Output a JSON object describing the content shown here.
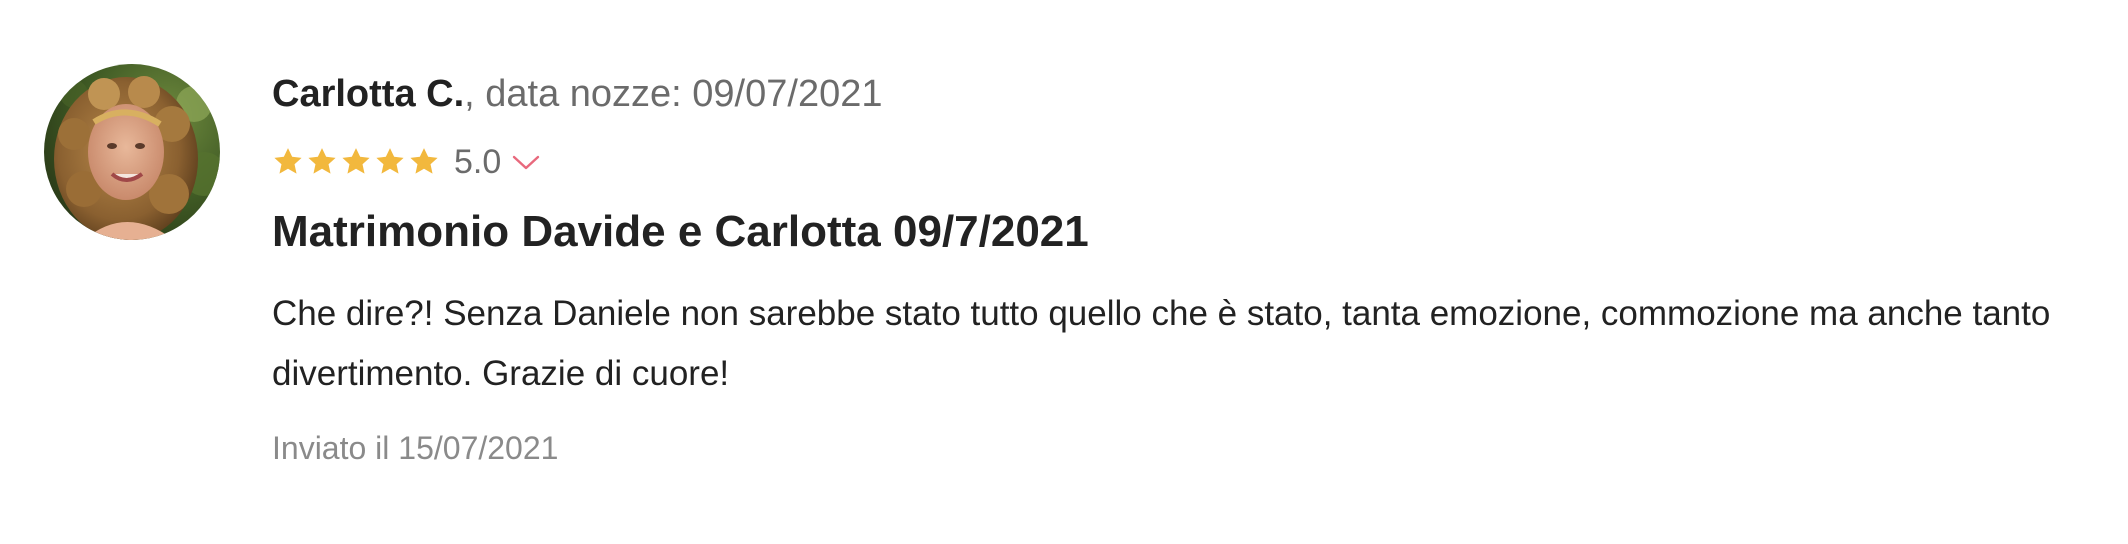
{
  "review": {
    "author": "Carlotta C.",
    "meta_suffix": ", data nozze: 09/07/2021",
    "rating": {
      "stars_filled": 5,
      "stars_total": 5,
      "value": "5.0",
      "star_color": "#f2b83d",
      "chevron_color": "#e8697d"
    },
    "title": "Matrimonio Davide e Carlotta 09/7/2021",
    "body": "Che dire?! Senza Daniele non sarebbe stato tutto quello che è stato, tanta emozione, commozione ma anche tanto divertimento. Grazie di cuore!",
    "sent": "Inviato il 15/07/2021"
  }
}
